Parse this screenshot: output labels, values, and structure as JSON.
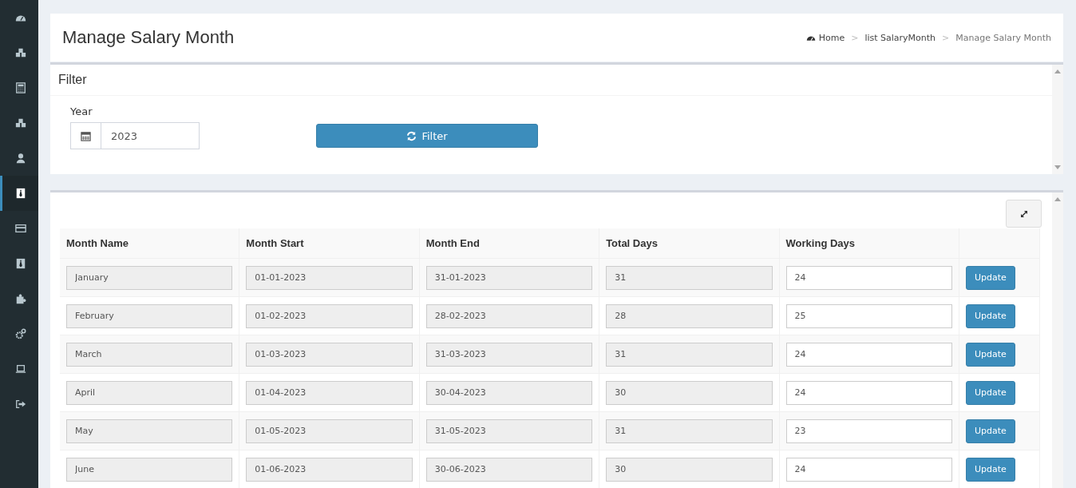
{
  "sidebar": {
    "items": [
      {
        "kind": "dashboard",
        "selected": false
      },
      {
        "kind": "cubes",
        "selected": false
      },
      {
        "kind": "calculator",
        "selected": false
      },
      {
        "kind": "cubes",
        "selected": false
      },
      {
        "kind": "user",
        "selected": false
      },
      {
        "kind": "tie",
        "selected": true
      },
      {
        "kind": "card",
        "selected": false
      },
      {
        "kind": "tie",
        "selected": false
      },
      {
        "kind": "puzzle",
        "selected": false
      },
      {
        "kind": "gears",
        "selected": false
      },
      {
        "kind": "laptop",
        "selected": false
      },
      {
        "kind": "signout",
        "selected": false
      }
    ]
  },
  "header": {
    "title": "Manage Salary Month",
    "breadcrumb": [
      {
        "label": "Home",
        "kind": "home"
      },
      {
        "label": "list SalaryMonth",
        "kind": "link",
        "separator": ">"
      },
      {
        "label": "Manage Salary Month",
        "kind": "current",
        "separator": ">"
      }
    ]
  },
  "filter": {
    "title": "Filter",
    "year_label": "Year",
    "year_value": "2023",
    "button": "Filter"
  },
  "table": {
    "columns": [
      "Month Name",
      "Month Start",
      "Month End",
      "Total Days",
      "Working Days"
    ],
    "rows": [
      {
        "month": "January",
        "start": "01-01-2023",
        "end": "31-01-2023",
        "total": "31",
        "working": "24",
        "button": "Update"
      },
      {
        "month": "February",
        "start": "01-02-2023",
        "end": "28-02-2023",
        "total": "28",
        "working": "25",
        "button": "Update"
      },
      {
        "month": "March",
        "start": "01-03-2023",
        "end": "31-03-2023",
        "total": "31",
        "working": "24",
        "button": "Update"
      },
      {
        "month": "April",
        "start": "01-04-2023",
        "end": "30-04-2023",
        "total": "30",
        "working": "24",
        "button": "Update"
      },
      {
        "month": "May",
        "start": "01-05-2023",
        "end": "31-05-2023",
        "total": "31",
        "working": "23",
        "button": "Update"
      },
      {
        "month": "June",
        "start": "01-06-2023",
        "end": "30-06-2023",
        "total": "30",
        "working": "24",
        "button": "Update"
      }
    ]
  }
}
